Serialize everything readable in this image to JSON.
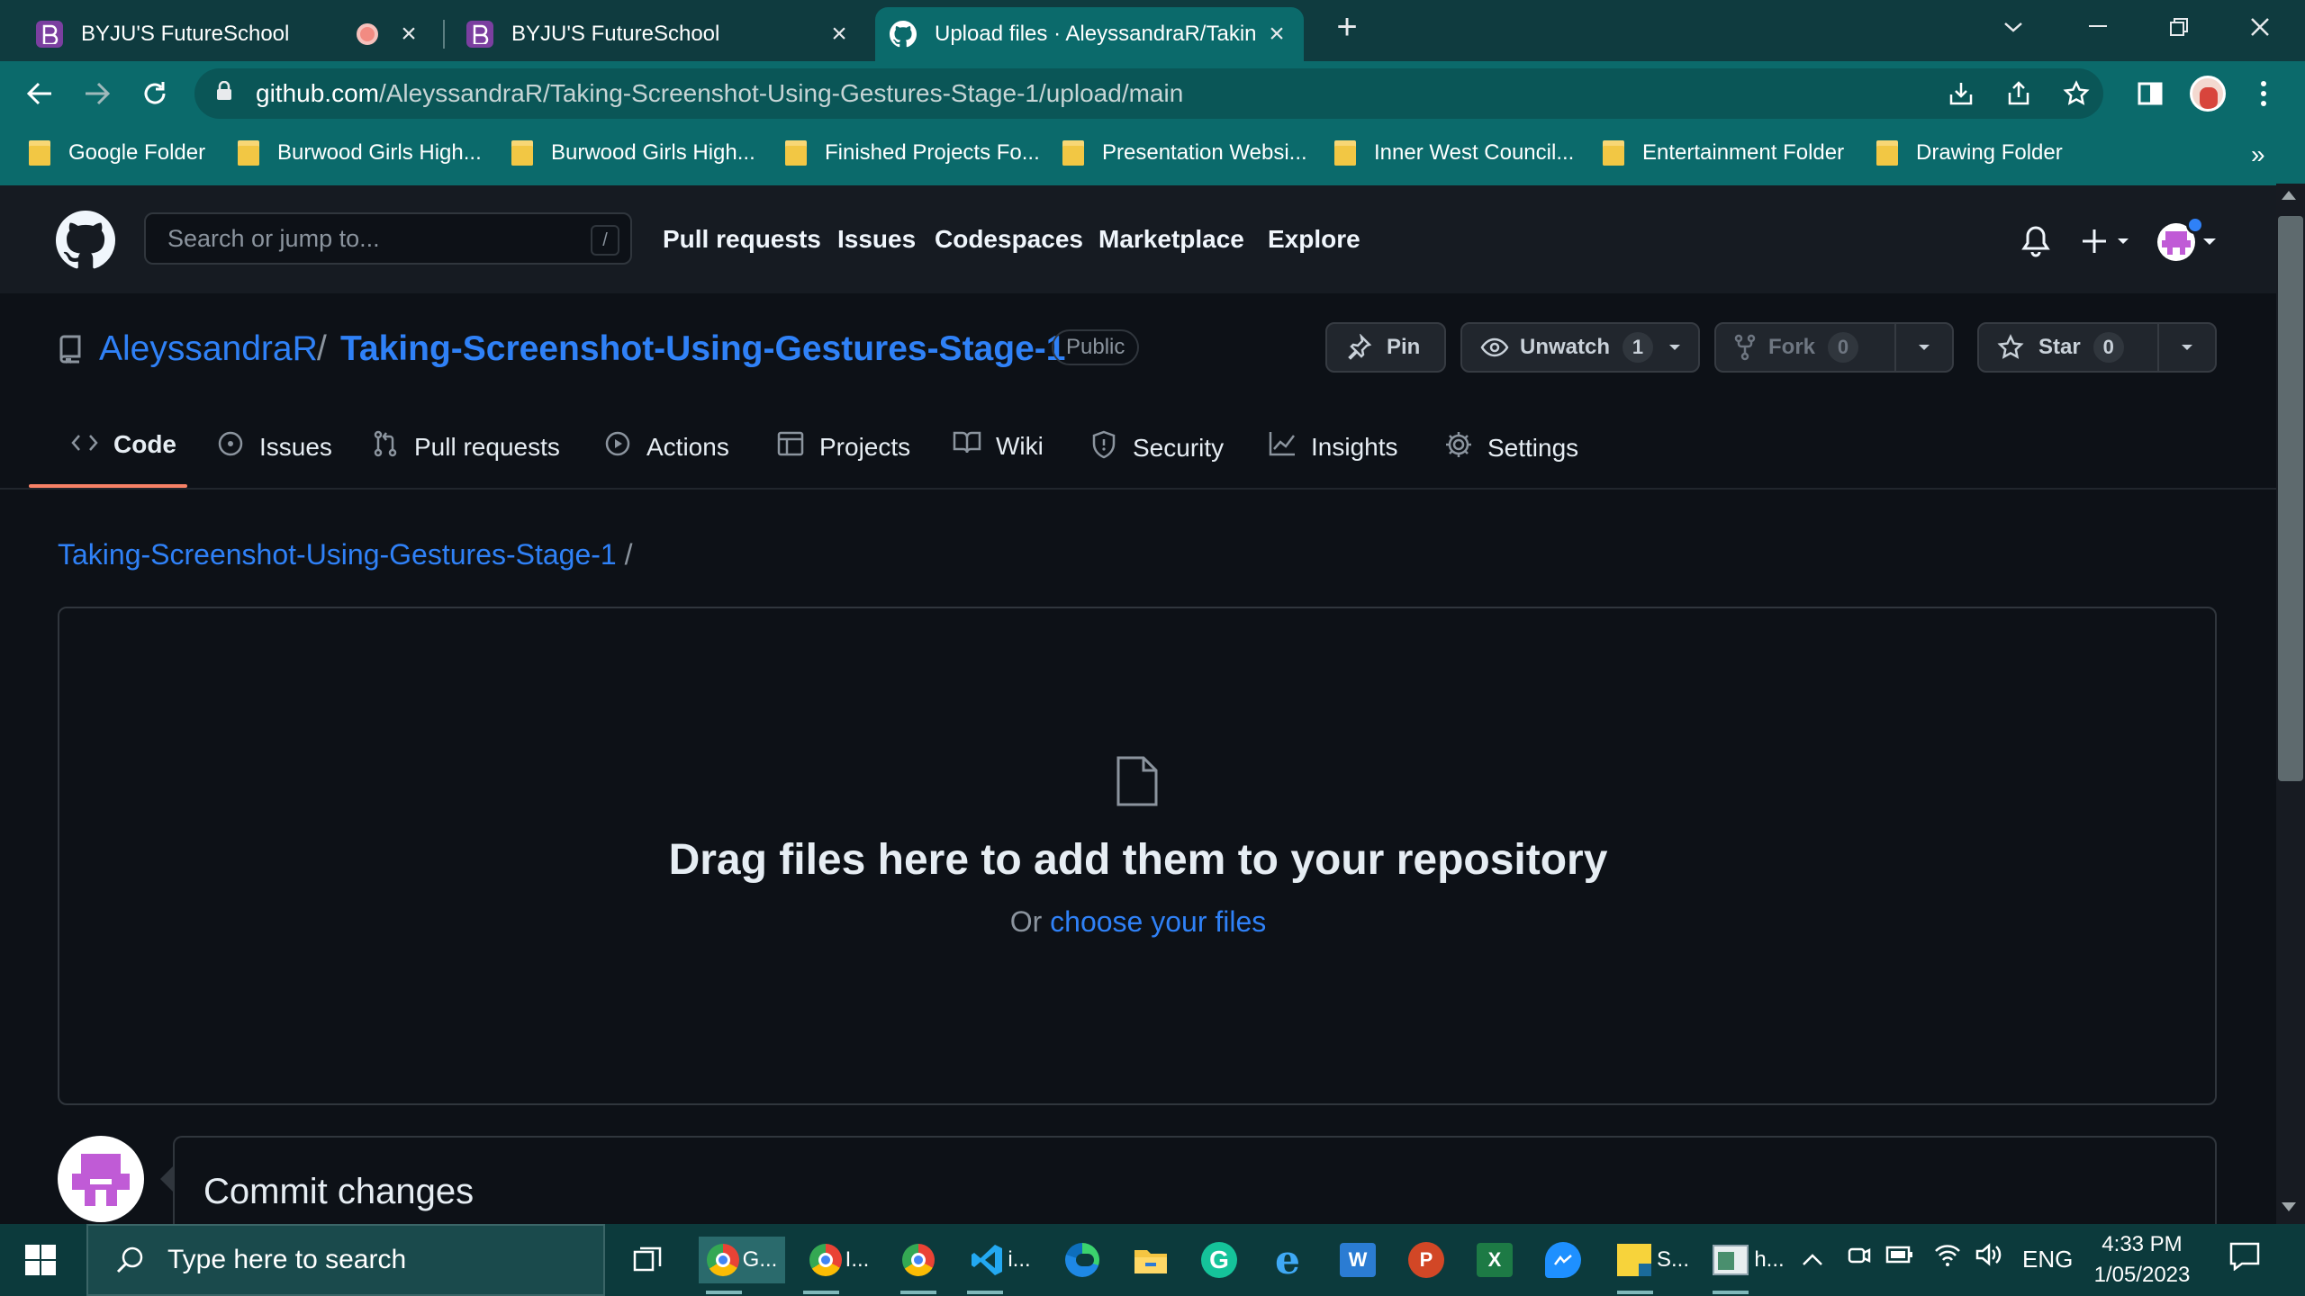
{
  "browser": {
    "tabs": [
      {
        "title": "BYJU'S FutureSchool",
        "icon": "byjus-icon"
      },
      {
        "title": "BYJU'S FutureSchool",
        "icon": "byjus-icon"
      },
      {
        "title": "Upload files · AleyssandraR/Takin",
        "icon": "github-icon"
      }
    ],
    "new_tab": "+",
    "url_host": "github.com",
    "url_path": "/AleyssandraR/Taking-Screenshot-Using-Gestures-Stage-1/upload/main",
    "bookmarks": [
      "Google Folder",
      "Burwood Girls High...",
      "Burwood Girls High...",
      "Finished Projects Fo...",
      "Presentation Websi...",
      "Inner West Council...",
      "Entertainment Folder",
      "Drawing Folder"
    ],
    "more_bookmarks": "»"
  },
  "github": {
    "search_placeholder": "Search or jump to...",
    "search_shortcut": "/",
    "nav": [
      "Pull requests",
      "Issues",
      "Codespaces",
      "Marketplace",
      "Explore"
    ],
    "repo_owner": "AleyssandraR",
    "repo_sep": "/",
    "repo_name": "Taking-Screenshot-Using-Gestures-Stage-1",
    "visibility": "Public",
    "pin_label": "Pin",
    "watch_label": "Unwatch",
    "watch_count": "1",
    "fork_label": "Fork",
    "fork_count": "0",
    "star_label": "Star",
    "star_count": "0",
    "tabs": [
      {
        "label": "Code",
        "icon": "code-icon"
      },
      {
        "label": "Issues",
        "icon": "issue-icon"
      },
      {
        "label": "Pull requests",
        "icon": "pull-request-icon"
      },
      {
        "label": "Actions",
        "icon": "play-icon"
      },
      {
        "label": "Projects",
        "icon": "table-icon"
      },
      {
        "label": "Wiki",
        "icon": "book-icon"
      },
      {
        "label": "Security",
        "icon": "shield-icon"
      },
      {
        "label": "Insights",
        "icon": "graph-icon"
      },
      {
        "label": "Settings",
        "icon": "gear-icon"
      }
    ],
    "breadcrumb_repo": "Taking-Screenshot-Using-Gestures-Stage-1",
    "breadcrumb_sep": "/",
    "drop_title": "Drag files here to add them to your repository",
    "drop_or": "Or",
    "drop_link": "choose your files",
    "commit_title": "Commit changes"
  },
  "taskbar": {
    "search_placeholder": "Type here to search",
    "apps": [
      {
        "icon": "chrome-icon",
        "label": "G..."
      },
      {
        "icon": "chrome-icon",
        "label": "I..."
      },
      {
        "icon": "chrome-icon",
        "label": ""
      },
      {
        "icon": "vscode-icon",
        "label": "i..."
      },
      {
        "icon": "edge-icon",
        "label": ""
      },
      {
        "icon": "file-explorer-icon",
        "label": ""
      },
      {
        "icon": "grammarly-icon",
        "label": ""
      },
      {
        "icon": "internet-explorer-icon",
        "label": ""
      },
      {
        "icon": "word-icon",
        "label": ""
      },
      {
        "icon": "powerpoint-icon",
        "label": ""
      },
      {
        "icon": "excel-icon",
        "label": ""
      },
      {
        "icon": "messenger-icon",
        "label": ""
      },
      {
        "icon": "sticky-notes-icon",
        "label": "S..."
      },
      {
        "icon": "app-window-icon",
        "label": "h..."
      }
    ],
    "lang": "ENG",
    "time": "4:33 PM",
    "date": "1/05/2023"
  },
  "colors": {
    "accent_link": "#2f81f7",
    "tab_underline": "#f78166",
    "browser_frame": "#0b6a6b"
  }
}
